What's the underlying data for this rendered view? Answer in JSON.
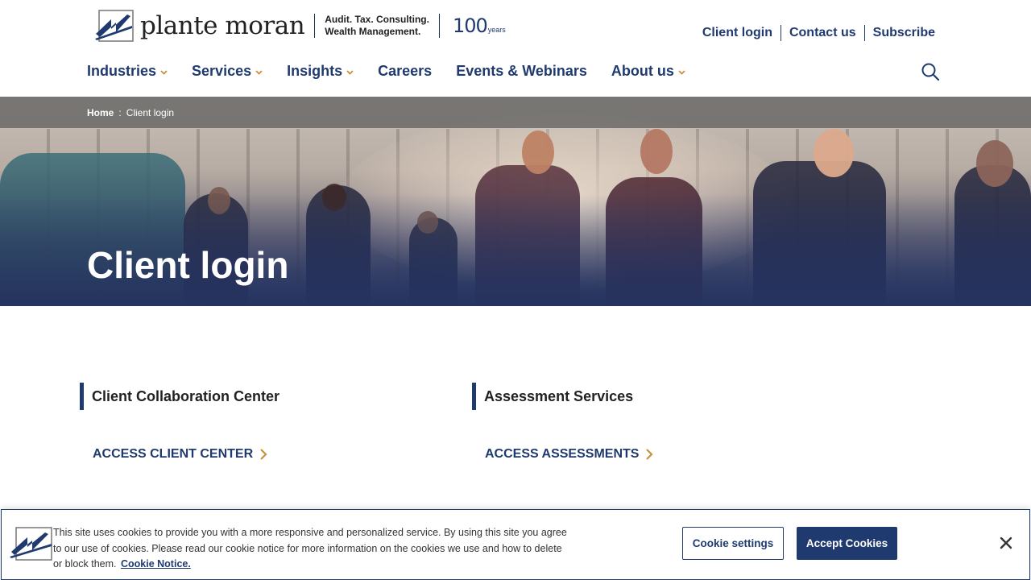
{
  "brand": {
    "name": "plante moran",
    "tagline_line1": "Audit. Tax. Consulting.",
    "tagline_line2": "Wealth Management.",
    "anniversary_number": "100",
    "anniversary_suffix": "years",
    "primary_color": "#1f3a6e"
  },
  "utility_nav": [
    {
      "label": "Client login"
    },
    {
      "label": "Contact us"
    },
    {
      "label": "Subscribe"
    }
  ],
  "main_nav": [
    {
      "label": "Industries",
      "has_dropdown": true
    },
    {
      "label": "Services",
      "has_dropdown": true
    },
    {
      "label": "Insights",
      "has_dropdown": true
    },
    {
      "label": "Careers",
      "has_dropdown": false
    },
    {
      "label": "Events & Webinars",
      "has_dropdown": false
    },
    {
      "label": "About us",
      "has_dropdown": true
    }
  ],
  "search": {
    "icon": "search-icon"
  },
  "breadcrumb": {
    "home": "Home",
    "separator": ":",
    "current": "Client login"
  },
  "hero": {
    "title": "Client login"
  },
  "sections": [
    {
      "title": "Client Collaboration Center",
      "link": "ACCESS CLIENT CENTER"
    },
    {
      "title": "Assessment Services",
      "link": "ACCESS ASSESSMENTS"
    }
  ],
  "cookie_banner": {
    "text": "This site uses cookies to provide you with a more responsive and personalized service. By using this site you agree to our use of cookies. Please read our cookie notice for more information on the cookies we use and how to delete or block them.",
    "link": "Cookie Notice.",
    "settings_button": "Cookie settings",
    "accept_button": "Accept Cookies"
  }
}
